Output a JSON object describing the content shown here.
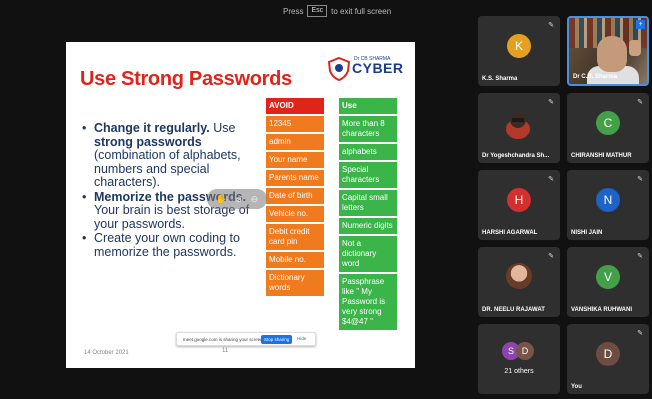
{
  "fullscreen_hint": {
    "prefix": "Press",
    "key": "Esc",
    "suffix": "to exit full screen"
  },
  "slide": {
    "title": "Use Strong Passwords",
    "logo_small": "Dr CB SHARMA",
    "logo_big": "CYBER",
    "bullets": [
      {
        "bold": "Change it regularly.",
        "rest": " Use ",
        "bold2": "strong passwords",
        "rest2": " (combination of alphabets, numbers and special characters)."
      },
      {
        "bold": "Memorize the passwords.",
        "rest": " Your brain is best storage of your passwords.",
        "bold2": "",
        "rest2": ""
      },
      {
        "bold": "",
        "rest": "Create your own coding to memorize the passwords.",
        "bold2": "",
        "rest2": ""
      }
    ],
    "avoid_header": "AVOID",
    "avoid": [
      "12345",
      "admin",
      "Your name",
      "Parents name",
      "Date of birth",
      "Vehicle no.",
      "Debit credit card pin",
      "Mobile no.",
      "Dictionary words"
    ],
    "use_header": "Use",
    "use": [
      "More than 8 characters",
      "alphabets",
      "Special characters",
      "Capital small letters",
      "Numeric digits",
      "Not a dictionary word",
      "Passphrase like \" My Password is very strong $4@47 \""
    ],
    "date": "14 October 2021",
    "page": "11"
  },
  "share_bar": {
    "text": "meet.google.com is sharing your screen.",
    "stop": "Stop sharing",
    "hide": "Hide"
  },
  "participants": [
    {
      "name": "K.S. Sharma",
      "initial": "K",
      "color": "#e6a020"
    },
    {
      "name": "Dr C.B. Sharma",
      "initial": "",
      "color": ""
    },
    {
      "name": "Dr Yogeshchandra Sh...",
      "initial": "",
      "color": ""
    },
    {
      "name": "CHIRANSHI MATHUR",
      "initial": "C",
      "color": "#43a047"
    },
    {
      "name": "HARSHI AGARWAL",
      "initial": "H",
      "color": "#d32f2f"
    },
    {
      "name": "NISHI JAIN",
      "initial": "N",
      "color": "#1e63c7"
    },
    {
      "name": "DR. NEELU RAJAWAT",
      "initial": "",
      "color": ""
    },
    {
      "name": "VANSHIKA RUHWANI",
      "initial": "V",
      "color": "#43a047"
    },
    {
      "name": "21 others",
      "initial_a": "S",
      "initial_b": "D",
      "color_a": "#8e44ad",
      "color_b": "#795548"
    },
    {
      "name": "You",
      "initial": "D",
      "color": "#6d4c41"
    }
  ]
}
